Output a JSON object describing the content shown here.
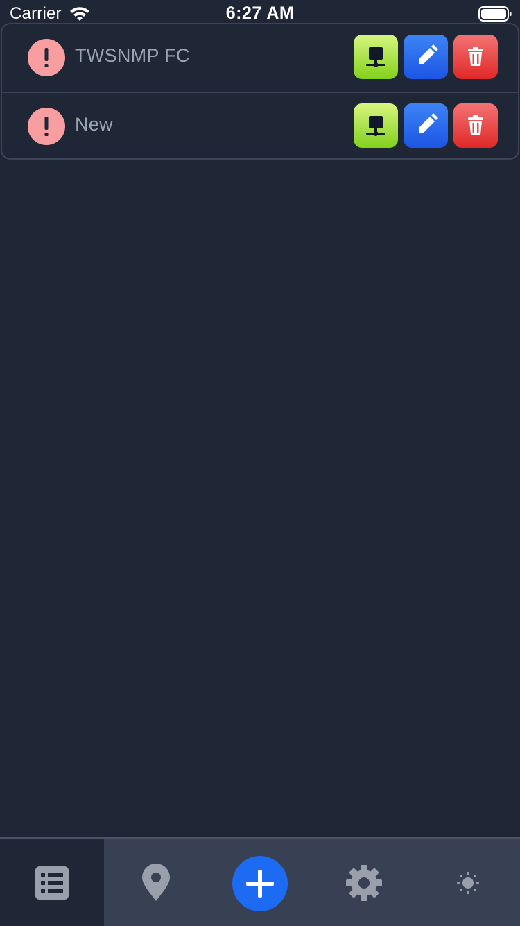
{
  "status_bar": {
    "carrier": "Carrier",
    "time": "6:27 AM"
  },
  "nodes": [
    {
      "label": "TWSNMP FC",
      "state_icon": "exclamation-icon",
      "state_color": "#f89ea0"
    },
    {
      "label": "New",
      "state_icon": "exclamation-icon",
      "state_color": "#f89ea0"
    }
  ],
  "row_actions": [
    "node-icon",
    "pencil-icon",
    "trash-icon"
  ],
  "tabbar": {
    "tabs": [
      {
        "icon": "list-icon",
        "active": true
      },
      {
        "icon": "map-pin-icon",
        "active": false
      },
      {
        "icon": "plus-icon",
        "active": false
      },
      {
        "icon": "gear-icon",
        "active": false
      },
      {
        "icon": "sun-icon",
        "active": false
      }
    ]
  },
  "colors": {
    "background": "#1f2737",
    "tabbar": "#374153",
    "accent_blue": "#1d6bf2",
    "node_button": "#82d11c",
    "edit_button": "#1c55e3",
    "delete_button": "#e02828",
    "state_error": "#f89ea0"
  }
}
